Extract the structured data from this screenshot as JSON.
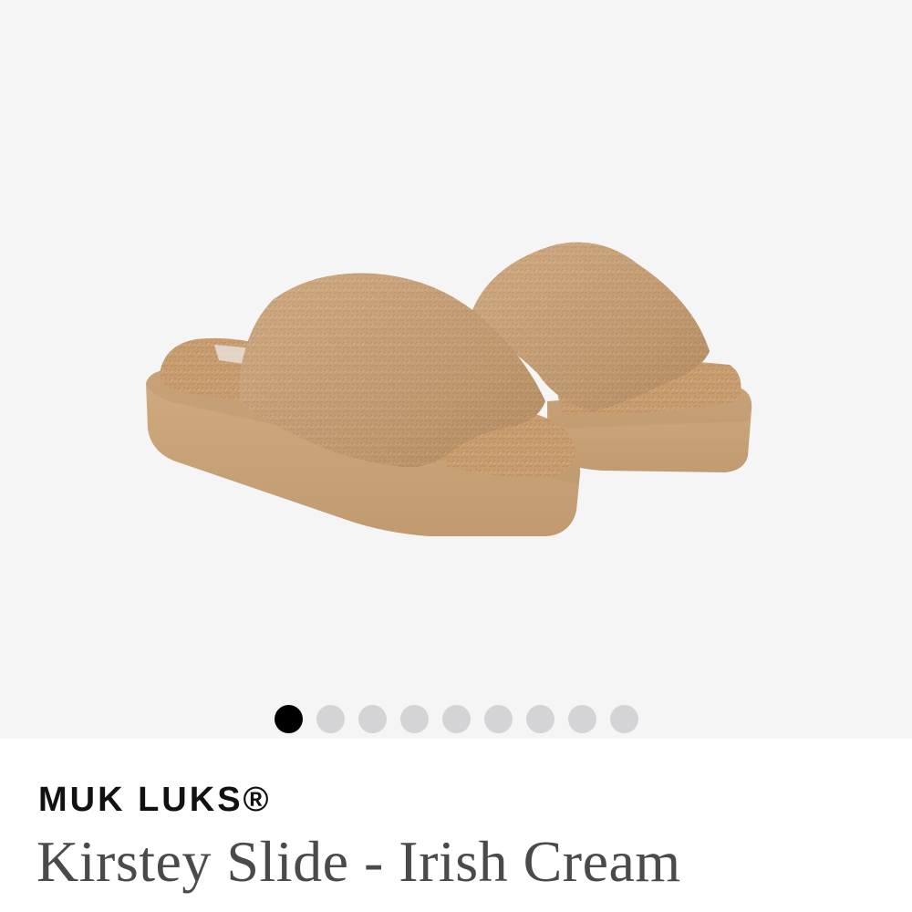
{
  "gallery": {
    "image_alt": "Kirstey Slide - Irish Cream",
    "dot_count": 9,
    "active_index": 0
  },
  "product": {
    "brand": "MUK LUKS®",
    "name": "Kirstey Slide - Irish Cream"
  },
  "colors": {
    "background": "#f5f5f6",
    "dot_active": "#000000",
    "dot_inactive": "#d4d4d6",
    "fur": "#c49a6c",
    "sole": "#c9a57b"
  }
}
